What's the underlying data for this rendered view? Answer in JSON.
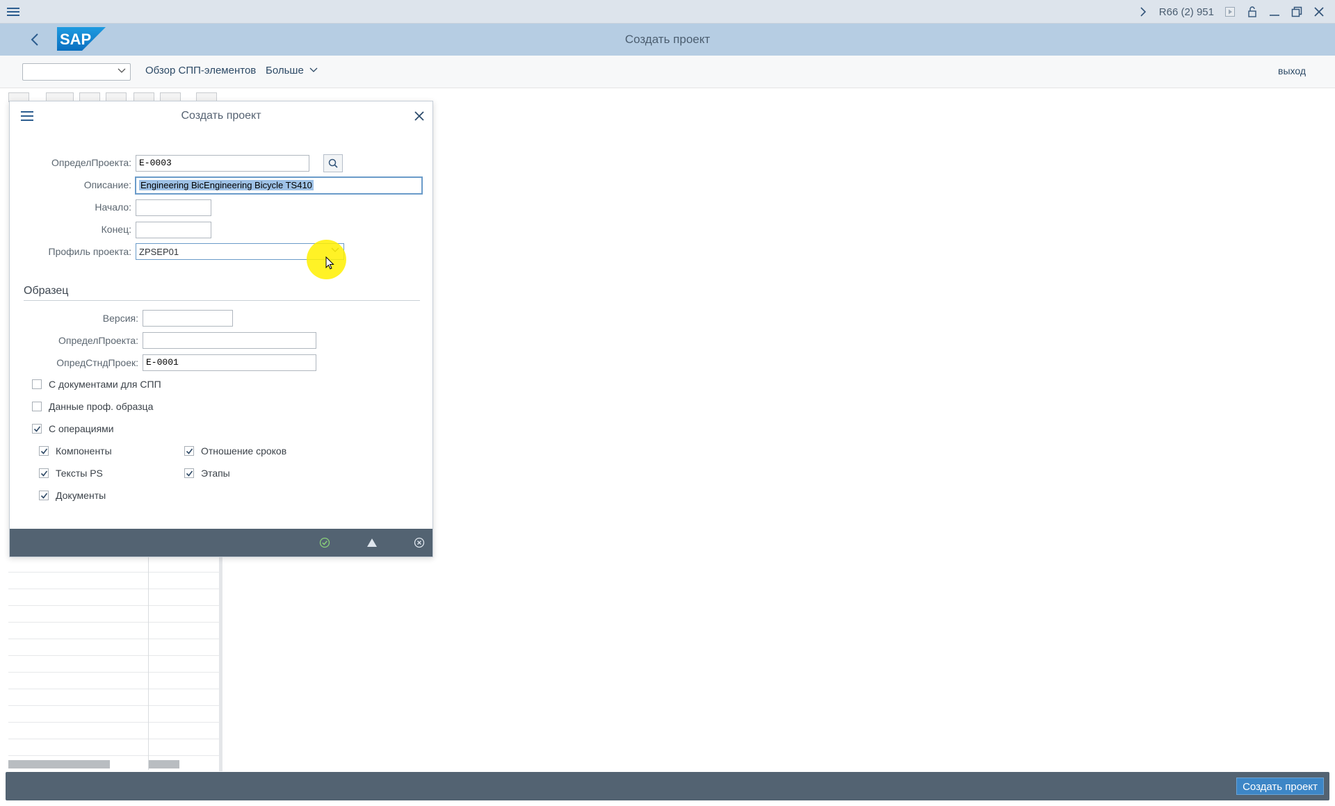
{
  "system_bar": {
    "system_id": "R66 (2) 951"
  },
  "header": {
    "title": "Создать проект",
    "brand": "SAP"
  },
  "toolbar": {
    "command_field_value": "",
    "wbs_overview_label": "Обзор СПП-элементов",
    "more_label": "Больше",
    "exit_label": "выход"
  },
  "dialog": {
    "title": "Создать проект",
    "fields": {
      "project_def_label": "ОпределПроекта:",
      "project_def_value": "E-0003",
      "description_label": "Описание:",
      "description_value": "Engineering BicEngineering Bicycle TS410",
      "start_label": "Начало:",
      "start_value": "",
      "end_label": "Конец:",
      "end_value": "",
      "profile_label": "Профиль проекта:",
      "profile_value": "ZPSEP01"
    },
    "template": {
      "section_title": "Образец",
      "version_label": "Версия:",
      "version_value": "",
      "project_def_label": "ОпределПроекта:",
      "project_def_value": "",
      "std_project_label": "ОпредСтндПроек:",
      "std_project_value": "E-0001"
    },
    "checkboxes": {
      "wbs_docs": {
        "label": "С документами для СПП",
        "checked": false
      },
      "profile_data": {
        "label": "Данные проф. образца",
        "checked": false
      },
      "with_operations": {
        "label": "С операциями",
        "checked": true
      },
      "components": {
        "label": "Компоненты",
        "checked": true
      },
      "ps_texts": {
        "label": "Тексты PS",
        "checked": true
      },
      "documents": {
        "label": "Документы",
        "checked": true
      },
      "date_relations": {
        "label": "Отношение сроков",
        "checked": true
      },
      "milestones": {
        "label": "Этапы",
        "checked": true
      }
    }
  },
  "status_bar": {
    "create_button_label": "Создать проект"
  },
  "colors": {
    "header_bg": "#b6cde3",
    "system_bar_bg": "#dde4ec",
    "footer_bg": "#536372",
    "accent_button": "#3d86c6",
    "cursor_highlight": "#fff000"
  }
}
